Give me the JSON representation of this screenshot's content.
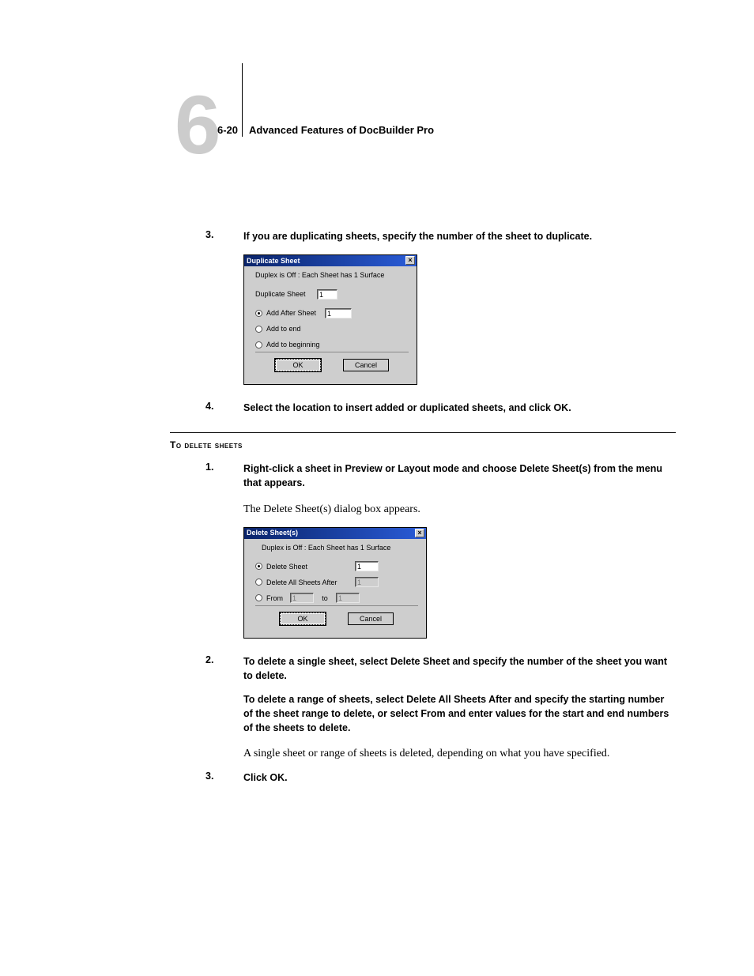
{
  "header": {
    "chapter_num": "6",
    "page_num": "6-20",
    "section_title": "Advanced Features of DocBuilder Pro"
  },
  "steps_top": [
    {
      "num": "3.",
      "text": "If you are duplicating sheets, specify the number of the sheet to duplicate."
    }
  ],
  "dialog1": {
    "title": "Duplicate Sheet",
    "close": "×",
    "duplex": "Duplex is Off : Each Sheet has 1 Surface",
    "dup_label": "Duplicate Sheet",
    "dup_value": "1",
    "opt1": "Add After Sheet",
    "opt1_value": "1",
    "opt2": "Add to end",
    "opt3": "Add to beginning",
    "ok": "OK",
    "cancel": "Cancel"
  },
  "step4": {
    "num": "4.",
    "text": "Select the location to insert added or duplicated sheets, and click OK."
  },
  "subhead": "To delete sheets",
  "del_steps": [
    {
      "num": "1.",
      "text": "Right-click a sheet in Preview or Layout mode and choose Delete Sheet(s) from the menu that appears."
    }
  ],
  "del_body1": "The Delete Sheet(s) dialog box appears.",
  "dialog2": {
    "title": "Delete Sheet(s)",
    "close": "×",
    "duplex": "Duplex is Off : Each Sheet has 1 Surface",
    "opt1": "Delete Sheet",
    "opt1_value": "1",
    "opt2": "Delete All Sheets After",
    "opt2_value": "1",
    "opt3": "From",
    "opt3_from": "1",
    "to_label": "to",
    "opt3_to": "1",
    "ok": "OK",
    "cancel": "Cancel"
  },
  "del_step2": {
    "num": "2.",
    "p1": "To delete a single sheet, select Delete Sheet and specify the number of the sheet you want to delete.",
    "p2": "To delete a range of sheets, select Delete All Sheets After and specify the starting number of the sheet range to delete, or select From and enter values for the start and end numbers of the sheets to delete."
  },
  "del_body2": "A single sheet or range of sheets is deleted, depending on what you have specified.",
  "del_step3": {
    "num": "3.",
    "text": "Click OK."
  }
}
